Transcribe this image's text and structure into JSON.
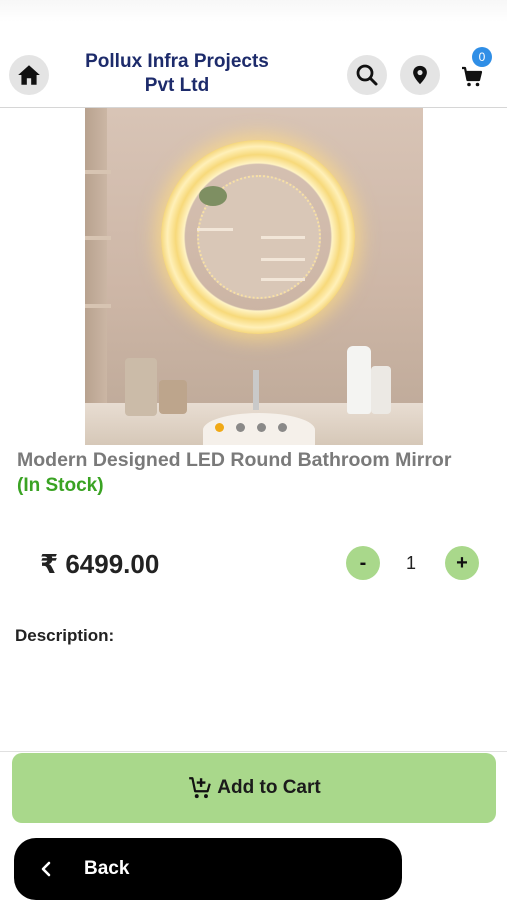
{
  "header": {
    "company_line1": "Pollux Infra Projects",
    "company_line2": "Pvt Ltd",
    "cart_count": "0",
    "icons": [
      "home-icon",
      "search-icon",
      "location-pin-icon",
      "cart-icon"
    ]
  },
  "product": {
    "image_alt": "LED round bathroom mirror",
    "carousel": {
      "total": 4,
      "active": 0
    },
    "title": "Modern Designed LED Round Bathroom Mirror",
    "stock_status": "(In Stock)",
    "price": "₹ 6499.00",
    "quantity": "1",
    "minus_label": "-",
    "plus_label": "+",
    "description_label": "Description:"
  },
  "actions": {
    "add_to_cart_label": "Add to Cart",
    "back_label": "Back"
  },
  "colors": {
    "brand_text": "#1d2b6b",
    "stock_green": "#3aa323",
    "button_green": "#a9d88b",
    "badge_blue": "#2f8ee6"
  }
}
